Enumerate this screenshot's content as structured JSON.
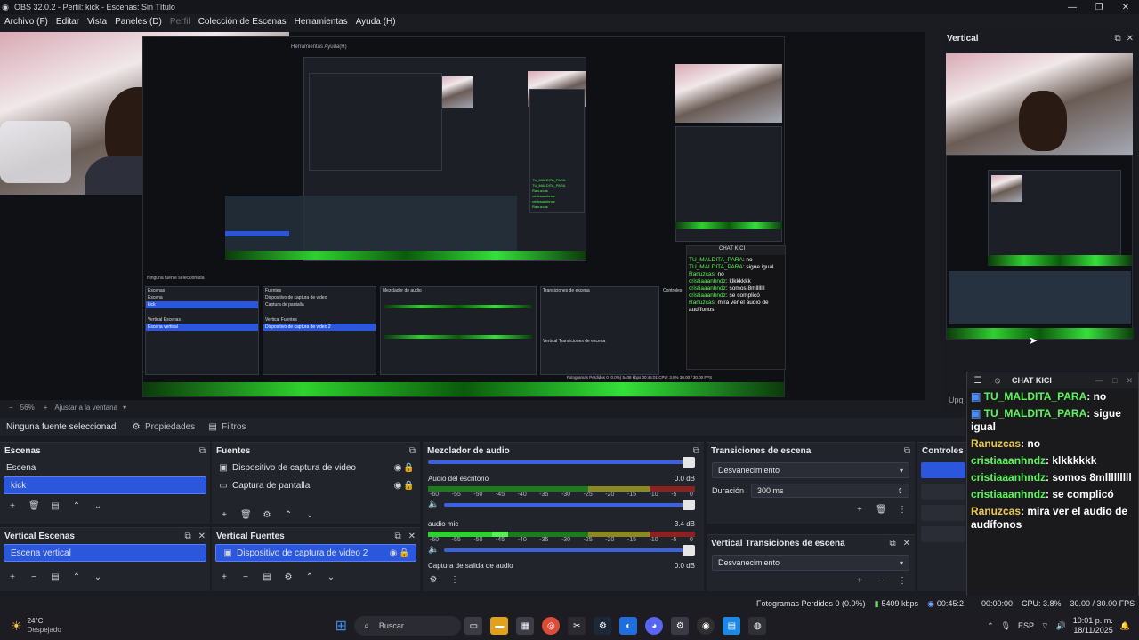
{
  "window": {
    "title": "OBS 32.0.2 - Perfil: kick - Escenas: Sin Título",
    "controls": [
      "—",
      "❐",
      "✕"
    ]
  },
  "menu": [
    {
      "label": "Archivo (F)",
      "dim": false
    },
    {
      "label": "Editar",
      "dim": false
    },
    {
      "label": "Vista",
      "dim": false
    },
    {
      "label": "Paneles (D)",
      "dim": false
    },
    {
      "label": "Perfil",
      "dim": true
    },
    {
      "label": "Colección de Escenas",
      "dim": false
    },
    {
      "label": "Herramientas",
      "dim": false
    },
    {
      "label": "Ayuda (H)",
      "dim": false
    }
  ],
  "preview": {
    "zoom": "56%",
    "fit_label": "Ajustar a la ventana",
    "nested": {
      "tabs": "Herramientas   Ayuda(H)",
      "chat_title": "CHAT KICI",
      "no_source": "Ninguna fuente seleccionada",
      "scenes_title": "Escenas",
      "sources_title": "Fuentes",
      "mixer_title": "Mezclador de audio",
      "transitions_title": "Transiciones de escena",
      "controls_title": "Controles",
      "scene_items": [
        "Escena",
        "kick"
      ],
      "source_items": [
        "Dispositivo de captura de video",
        "Captura de pantalla"
      ],
      "v_scenes_title": "Vertical Escenas",
      "v_sources_title": "Vertical Fuentes",
      "v_scene_item": "Escena vertical",
      "v_source_item": "Dispositivo de captura de video 2",
      "v_trans_title": "Vertical Transiciones de escena",
      "chat_lines": [
        {
          "nick": "TU_MALDITA_PARA",
          "text": ": no"
        },
        {
          "nick": "TU_MALDITA_PARA",
          "text": ": sigue igual"
        },
        {
          "nick": "Ranuzcas",
          "text": ": no"
        },
        {
          "nick": "cristiaaanhndz",
          "text": ": klkkkkkk"
        },
        {
          "nick": "cristiaaanhndz",
          "text": ": somos 8mlllllll"
        },
        {
          "nick": "cristiaaanhndz",
          "text": ": se complicó"
        },
        {
          "nick": "Ranuzcas",
          "text": ": mira ver el audio de audífonos"
        }
      ],
      "stats": "Fotogramas Perdidos 0 (0.0%)   5408 kbps   00:45:01   CPU: 3.8%   30.00 / 30.00 FPS"
    }
  },
  "vertical_dock": {
    "title": "Vertical",
    "buttons": [
      "⧉",
      "✕"
    ]
  },
  "source_toolbar": {
    "label": "Ninguna fuente seleccionad",
    "properties": "Propiedades",
    "filters": "Filtros"
  },
  "scenes": {
    "title": "Escenas",
    "items": [
      "Escena",
      "kick"
    ],
    "selected": 1
  },
  "sources": {
    "title": "Fuentes",
    "items": [
      "Dispositivo de captura de video",
      "Captura de pantalla"
    ]
  },
  "mixer": {
    "title": "Mezclador de audio",
    "channels": [
      {
        "name": "Audio del escritorio",
        "db": "0.0 dB",
        "level": 0.0
      },
      {
        "name": "audio mic",
        "db": "3.4 dB",
        "level": 0.3
      }
    ],
    "next": "Captura de salida de audio",
    "next_db": "0.0 dB",
    "scale": [
      "-60",
      "-55",
      "-50",
      "-45",
      "-40",
      "-35",
      "-30",
      "-25",
      "-20",
      "-15",
      "-10",
      "-5",
      "0"
    ]
  },
  "transitions": {
    "title": "Transiciones de escena",
    "type": "Desvanecimiento",
    "duration_label": "Duración",
    "duration_value": "300 ms"
  },
  "v_scenes": {
    "title": "Vertical Escenas",
    "items": [
      "Escena vertical"
    ]
  },
  "v_sources": {
    "title": "Vertical Fuentes",
    "items": [
      "Dispositivo de captura de video 2"
    ]
  },
  "v_transitions": {
    "title": "Vertical Transiciones de escena",
    "type": "Desvanecimiento"
  },
  "controls": {
    "title": "Controles",
    "peek": "Upg"
  },
  "chat": {
    "title": "CHAT KICI",
    "messages": [
      {
        "nick": "TU_MALDITA_PARA",
        "text": ": no",
        "badge": true
      },
      {
        "nick": "TU_MALDITA_PARA",
        "text": ": sigue igual",
        "badge": true
      },
      {
        "nick": "Ranuzcas",
        "text": ": no",
        "badge": false
      },
      {
        "nick": "cristiaaanhndz",
        "text": ": klkkkkkk",
        "badge": false
      },
      {
        "nick": "cristiaaanhndz",
        "text": ": somos 8mlllllllll",
        "badge": false
      },
      {
        "nick": "cristiaaanhndz",
        "text": ": se complicó",
        "badge": false
      },
      {
        "nick": "Ranuzcas",
        "text": ": mira ver el audio de audífonos",
        "badge": false
      }
    ]
  },
  "status": {
    "frames": "Fotogramas Perdidos 0 (0.0%)",
    "bitrate": "5409 kbps",
    "live_time": "00:45:2",
    "rec_time": "00:00:00",
    "cpu": "CPU: 3.8%",
    "fps": "30.00 / 30.00 FPS"
  },
  "taskbar": {
    "weather_temp": "24°C",
    "weather_desc": "Despejado",
    "search": "Buscar",
    "lang": "ESP",
    "time": "10:01 p. m.",
    "date": "18/11/2025"
  },
  "colors": {
    "accent": "#2b57dd",
    "kick_green": "#53fc18",
    "meter_green": "#2fd12f"
  }
}
